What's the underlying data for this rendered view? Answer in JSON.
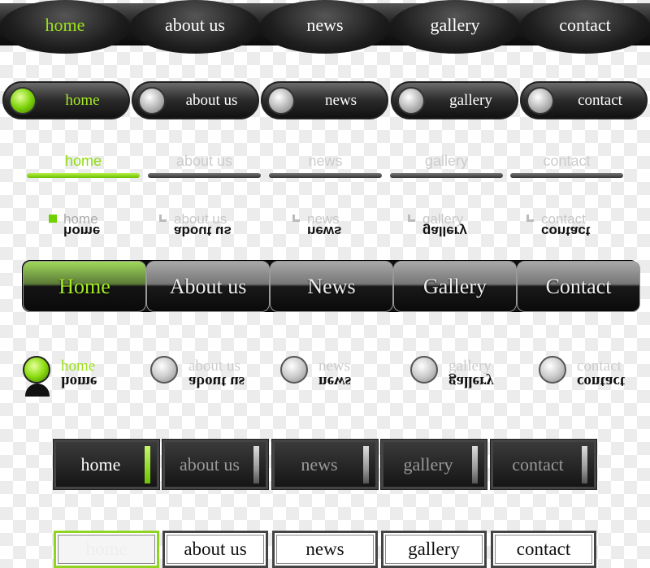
{
  "accent_color": "#9be01a",
  "menus": {
    "nav1": {
      "style": "dark-bar-oval-tabs",
      "active": 0,
      "items": [
        "home",
        "about us",
        "news",
        "gallery",
        "contact"
      ]
    },
    "nav2": {
      "style": "pill-buttons-radio",
      "active": 0,
      "items": [
        "home",
        "about us",
        "news",
        "gallery",
        "contact"
      ]
    },
    "nav3": {
      "style": "underline-tabs",
      "active": 0,
      "items": [
        "home",
        "about us",
        "news",
        "gallery",
        "contact"
      ]
    },
    "nav4": {
      "style": "square-bullet-reflected",
      "active": 0,
      "items": [
        "home",
        "about us",
        "news",
        "gallery",
        "contact"
      ]
    },
    "nav5": {
      "style": "glossy-dotted-tabs",
      "active": 0,
      "items": [
        "Home",
        "About us",
        "News",
        "Gallery",
        "Contact"
      ]
    },
    "nav6": {
      "style": "ball-bullet-reflected",
      "active": 0,
      "items": [
        "home",
        "about us",
        "news",
        "gallery",
        "contact"
      ]
    },
    "nav7": {
      "style": "dark-boxes-indicator",
      "active": 0,
      "items": [
        "home",
        "about us",
        "news",
        "gallery",
        "contact"
      ]
    },
    "nav8": {
      "style": "white-boxes",
      "active": 0,
      "items": [
        "home",
        "about us",
        "news",
        "gallery",
        "contact"
      ]
    }
  }
}
